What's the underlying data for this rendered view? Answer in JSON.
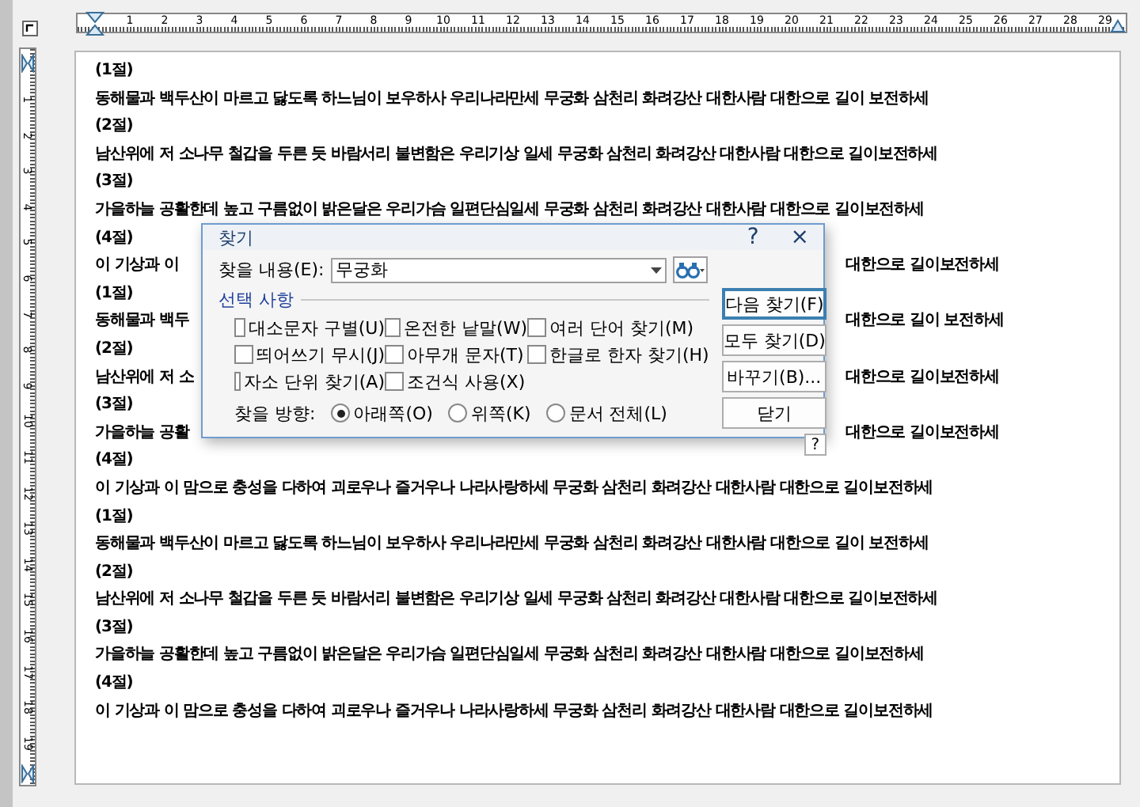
{
  "ruler_top": {
    "numbers": [
      "1",
      "2",
      "3",
      "4",
      "5",
      "6",
      "7",
      "8",
      "9",
      "10",
      "11",
      "12",
      "13",
      "14",
      "15",
      "16",
      "17",
      "18",
      "19",
      "20",
      "21",
      "22",
      "23",
      "24",
      "25",
      "26",
      "27",
      "28",
      "29"
    ]
  },
  "ruler_left": {
    "numbers": [
      "1",
      "2",
      "3",
      "4",
      "5",
      "6",
      "7",
      "8",
      "9",
      "10",
      "11",
      "12",
      "13",
      "14",
      "15",
      "16",
      "17",
      "18",
      "19"
    ]
  },
  "document": {
    "lines": [
      {
        "kind": "full",
        "text": "(1절)"
      },
      {
        "kind": "full",
        "text": "동해물과 백두산이 마르고 닳도록 하느님이 보우하사 우리나라만세 무궁화 삼천리 화려강산 대한사람 대한으로 길이 보전하세"
      },
      {
        "kind": "full",
        "text": "(2절)"
      },
      {
        "kind": "full",
        "text": "남산위에 저 소나무 철갑을 두른 듯 바람서리 불변함은 우리기상 일세 무궁화 삼천리 화려강산 대한사람 대한으로 길이보전하세"
      },
      {
        "kind": "full",
        "text": "(3절)"
      },
      {
        "kind": "full",
        "text": "가을하늘 공활한데 높고 구름없이 밝은달은 우리가슴 일편단심일세 무궁화 삼천리 화려강산 대한사람 대한으로 길이보전하세"
      },
      {
        "kind": "full",
        "text": "(4절)"
      },
      {
        "kind": "split",
        "left": "이 기상과 이",
        "right": "대한으로 길이보전하세"
      },
      {
        "kind": "full",
        "text": "(1절)"
      },
      {
        "kind": "split",
        "left": "동해물과 백두",
        "right": "대한으로 길이 보전하세"
      },
      {
        "kind": "full",
        "text": "(2절)"
      },
      {
        "kind": "split",
        "left": "남산위에 저 소",
        "right": "대한으로 길이보전하세"
      },
      {
        "kind": "full",
        "text": "(3절)"
      },
      {
        "kind": "split",
        "left": "가을하늘 공활",
        "right": "대한으로 길이보전하세"
      },
      {
        "kind": "full",
        "text": "(4절)"
      },
      {
        "kind": "full",
        "text": "이 기상과 이 맘으로 충성을 다하여 괴로우나 즐거우나 나라사랑하세 무궁화 삼천리 화려강산 대한사람 대한으로 길이보전하세"
      },
      {
        "kind": "full",
        "text": "(1절)"
      },
      {
        "kind": "full",
        "text": "동해물과 백두산이 마르고 닳도록 하느님이 보우하사 우리나라만세 무궁화 삼천리 화려강산 대한사람 대한으로 길이 보전하세"
      },
      {
        "kind": "full",
        "text": "(2절)"
      },
      {
        "kind": "full",
        "text": "남산위에 저 소나무 철갑을 두른 듯 바람서리 불변함은 우리기상 일세 무궁화 삼천리 화려강산 대한사람 대한으로 길이보전하세"
      },
      {
        "kind": "full",
        "text": "(3절)"
      },
      {
        "kind": "full",
        "text": "가을하늘 공활한데 높고 구름없이 밝은달은 우리가슴 일편단심일세 무궁화 삼천리 화려강산 대한사람 대한으로 길이보전하세"
      },
      {
        "kind": "full",
        "text": "(4절)"
      },
      {
        "kind": "full",
        "text": "이 기상과 이 맘으로 충성을 다하여 괴로우나 즐거우나 나라사랑하세 무궁화 삼천리 화려강산 대한사람 대한으로 길이보전하세"
      }
    ]
  },
  "find_dialog": {
    "title": "찾기",
    "help": "?",
    "close": "×",
    "find_label": "찾을 내용(E):",
    "find_value": "무궁화",
    "options_title": "선택 사항",
    "options": [
      {
        "label": "대소문자 구별(U)",
        "checked": false
      },
      {
        "label": "온전한 낱말(W)",
        "checked": false
      },
      {
        "label": "여러 단어 찾기(M)",
        "checked": false
      },
      {
        "label": "띄어쓰기 무시(J)",
        "checked": false
      },
      {
        "label": "아무개 문자(T)",
        "checked": false
      },
      {
        "label": "한글로 한자 찾기(H)",
        "checked": false
      },
      {
        "label": "자소 단위 찾기(A)",
        "checked": false
      },
      {
        "label": "조건식 사용(X)",
        "checked": false
      }
    ],
    "direction_label": "찾을 방향:",
    "directions": [
      {
        "label": "아래쪽(O)",
        "selected": true
      },
      {
        "label": "위쪽(K)",
        "selected": false
      },
      {
        "label": "문서 전체(L)",
        "selected": false
      }
    ],
    "buttons": [
      {
        "label": "다음 찾기(F)",
        "default": true
      },
      {
        "label": "모두 찾기(D)",
        "default": false
      },
      {
        "label": "바꾸기(B)...",
        "default": false
      },
      {
        "label": "닫기",
        "default": false
      }
    ],
    "corner_help": "?"
  }
}
